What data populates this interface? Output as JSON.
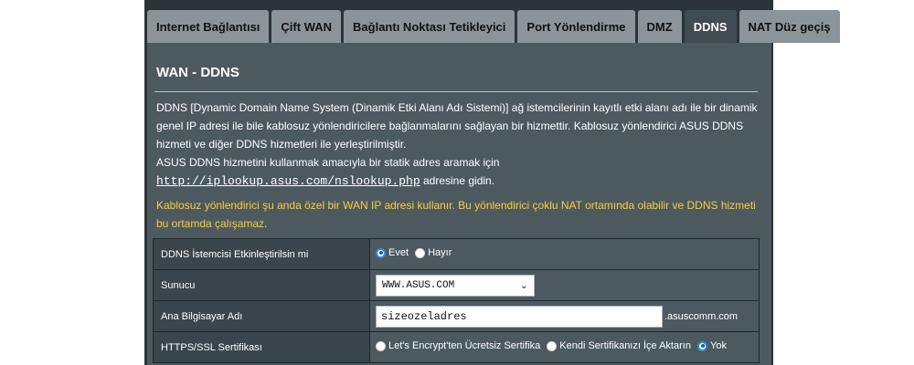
{
  "tabs": [
    {
      "label": "Internet Bağlantısı"
    },
    {
      "label": "Çift WAN"
    },
    {
      "label": "Bağlantı Noktası Tetikleyici"
    },
    {
      "label": "Port Yönlendirme"
    },
    {
      "label": "DMZ"
    },
    {
      "label": "DDNS",
      "active": true
    },
    {
      "label": "NAT Düz geçiş"
    }
  ],
  "page": {
    "title": "WAN - DDNS",
    "description_1": "DDNS [Dynamic Domain Name System (Dinamik Etki Alanı Adı Sistemi)] ağ istemcilerinin kayıtlı etki alanı adı ile bir dinamik genel IP adresi ile bile kablosuz yönlendiricilere bağlanmalarını sağlayan bir hizmettir. Kablosuz yönlendirici ASUS DDNS hizmeti ve diğer DDNS hizmetleri ile yerleştirilmiştir.",
    "description_2_prefix": "ASUS DDNS hizmetini kullanmak amacıyla bir statik adres aramak için ",
    "lookup_link": "http://iplookup.asus.com/nslookup.php",
    "description_2_suffix": " adresine gidin.",
    "warning": "Kablosuz yönlendirici şu anda özel bir WAN IP adresi kullanır. Bu yönlendirici çoklu NAT ortamında olabilir ve DDNS hizmeti bu ortamda çalışamaz."
  },
  "settings": {
    "enable": {
      "label": "DDNS İstemcisi Etkinleştirilsin mi",
      "options": [
        "Evet",
        "Hayır"
      ],
      "selected": "Evet"
    },
    "server": {
      "label": "Sunucu",
      "value": "WWW.ASUS.COM"
    },
    "hostname": {
      "label": "Ana Bilgisayar Adı",
      "value": "sizeozeladres",
      "suffix": ".asuscomm.com"
    },
    "ssl": {
      "label": "HTTPS/SSL Sertifikası",
      "options": [
        "Let's Encrypt'ten Ücretsiz Sertifika",
        "Kendi Sertifikanızı İçe Aktarın",
        "Yok"
      ],
      "selected": "Yok"
    }
  },
  "colors": {
    "frame": "#2b3438",
    "panel": "#4c5a60",
    "tab_inactive": "#8b9599",
    "tab_active": "#3f4c52",
    "warning": "#ffcc33",
    "radio_checked": "#2f8de4"
  }
}
